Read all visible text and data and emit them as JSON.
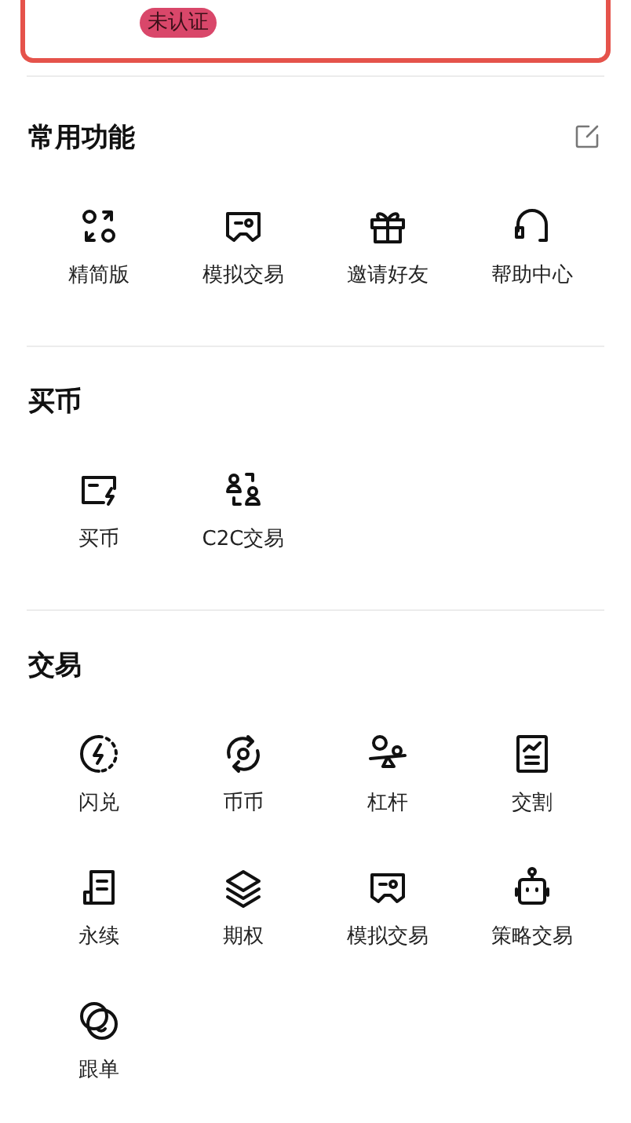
{
  "account_card": {
    "badge": "未认证"
  },
  "sections": [
    {
      "title": "常用功能",
      "editable": true,
      "items": [
        {
          "label": "精简版"
        },
        {
          "label": "模拟交易"
        },
        {
          "label": "邀请好友"
        },
        {
          "label": "帮助中心"
        }
      ]
    },
    {
      "title": "买币",
      "editable": false,
      "items": [
        {
          "label": "买币"
        },
        {
          "label": "C2C交易"
        }
      ]
    },
    {
      "title": "交易",
      "editable": false,
      "items": [
        {
          "label": "闪兑"
        },
        {
          "label": "币币"
        },
        {
          "label": "杠杆"
        },
        {
          "label": "交割"
        },
        {
          "label": "永续"
        },
        {
          "label": "期权"
        },
        {
          "label": "模拟交易"
        },
        {
          "label": "策略交易"
        },
        {
          "label": "跟单"
        }
      ]
    }
  ]
}
